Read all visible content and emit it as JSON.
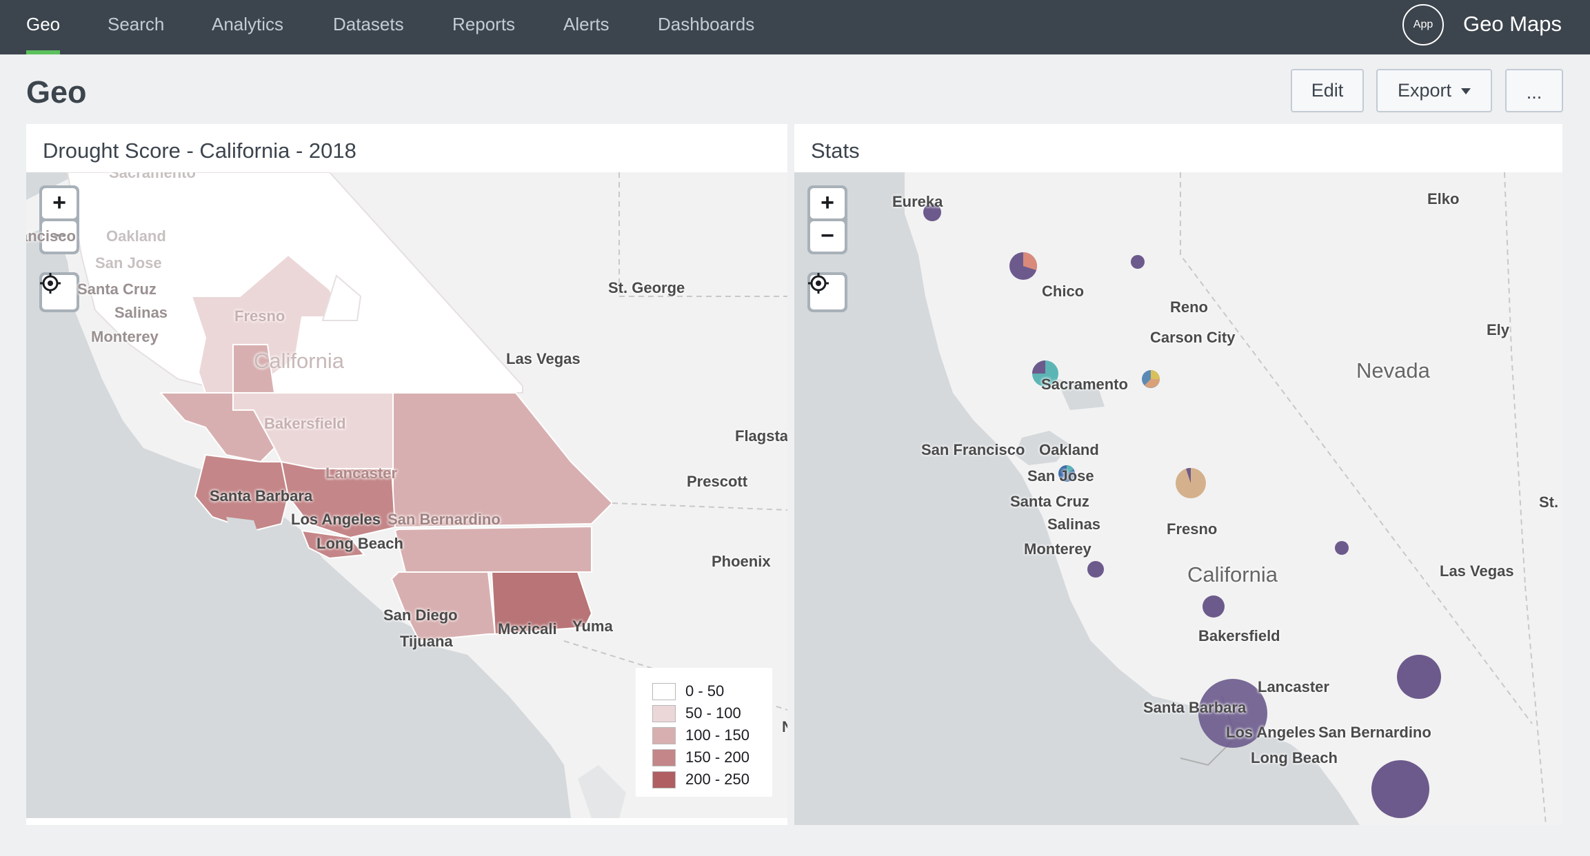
{
  "nav": {
    "tabs": [
      {
        "label": "Geo",
        "active": true
      },
      {
        "label": "Search"
      },
      {
        "label": "Analytics"
      },
      {
        "label": "Datasets"
      },
      {
        "label": "Reports"
      },
      {
        "label": "Alerts"
      },
      {
        "label": "Dashboards"
      }
    ],
    "app_badge": "App",
    "app_title": "Geo Maps"
  },
  "page": {
    "title": "Geo",
    "edit_label": "Edit",
    "export_label": "Export",
    "more_label": "..."
  },
  "left_panel": {
    "title": "Drought Score - California - 2018",
    "zoom_in": "+",
    "zoom_out": "−",
    "labels": {
      "sacramento": "Sacramento",
      "francisco": "Francisco",
      "oakland": "Oakland",
      "san_jose": "San Jose",
      "santa_cruz": "Santa Cruz",
      "salinas": "Salinas",
      "monterey": "Monterey",
      "fresno": "Fresno",
      "california": "California",
      "st_george": "St. George",
      "las_vegas": "Las Vegas",
      "bakersfield": "Bakersfield",
      "flagstaff": "Flagsta",
      "prescott": "Prescott",
      "lancaster": "Lancaster",
      "santa_barbara": "Santa Barbara",
      "los_angeles": "Los Angeles",
      "san_bernardino": "San Bernardino",
      "long_beach": "Long Beach",
      "phoenix": "Phoenix",
      "san_diego": "San Diego",
      "mexicali": "Mexicali",
      "yuma": "Yuma",
      "tijuana": "Tijuana",
      "edge_n": "N"
    },
    "legend": [
      {
        "label": "0 - 50",
        "color": "#ffffff"
      },
      {
        "label": "50 - 100",
        "color": "#ecd7d8"
      },
      {
        "label": "100 - 150",
        "color": "#d8afb0"
      },
      {
        "label": "150 - 200",
        "color": "#c48688"
      },
      {
        "label": "200 - 250",
        "color": "#b05e61"
      }
    ]
  },
  "right_panel": {
    "title": "Stats",
    "zoom_in": "+",
    "zoom_out": "−",
    "labels": {
      "eureka": "Eureka",
      "elko": "Elko",
      "chico": "Chico",
      "reno": "Reno",
      "carson_city": "Carson City",
      "ely": "Ely",
      "nevada": "Nevada",
      "sacramento": "Sacramento",
      "san_francisco": "San Francisco",
      "oakland": "Oakland",
      "san_jose": "San Jose",
      "santa_cruz": "Santa Cruz",
      "salinas": "Salinas",
      "monterey": "Monterey",
      "fresno": "Fresno",
      "st": "St.",
      "california": "California",
      "las_vegas": "Las Vegas",
      "bakersfield": "Bakersfield",
      "lancaster": "Lancaster",
      "santa_barbara": "Santa Barbara",
      "los_angeles": "Los Angeles",
      "san_bernardino": "San Bernardino",
      "long_beach": "Long Beach"
    }
  },
  "colors": {
    "nav_bg": "#3c444d",
    "nav_active_underline": "#5cc05c",
    "water": "#d5d9dc",
    "land": "#f2f2f2",
    "marker_primary": "#6c5a8c",
    "marker_secondary": "#d9a17a",
    "marker_teal": "#5cb5b5"
  }
}
